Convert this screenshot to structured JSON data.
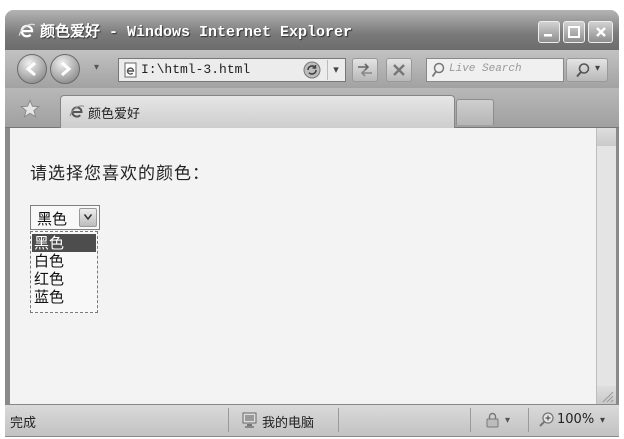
{
  "window": {
    "title": "颜色爱好 - Windows Internet Explorer"
  },
  "navbar": {
    "address": "I:\\html-3.html",
    "search_placeholder": "Live Search"
  },
  "tabs": [
    {
      "label": "颜色爱好",
      "active": true
    }
  ],
  "content": {
    "prompt": "请选择您喜欢的颜色：",
    "color_select": {
      "selected": "黑色",
      "open": true,
      "highlighted_index": 0,
      "options": [
        "黑色",
        "白色",
        "红色",
        "蓝色"
      ]
    }
  },
  "statusbar": {
    "status": "完成",
    "zone": "我的电脑",
    "zoom": "100%"
  },
  "icons": {
    "app": "ie-logo-icon",
    "back": "back-arrow-icon",
    "forward": "forward-arrow-icon",
    "refresh": "refresh-icon",
    "stop": "stop-icon",
    "search": "magnifier-icon",
    "favorites": "star-icon",
    "zone": "computer-icon",
    "zoom": "zoom-icon"
  },
  "colors": {
    "option_highlight": "#4d4d4d",
    "titlebar": "#7a7a7a"
  }
}
